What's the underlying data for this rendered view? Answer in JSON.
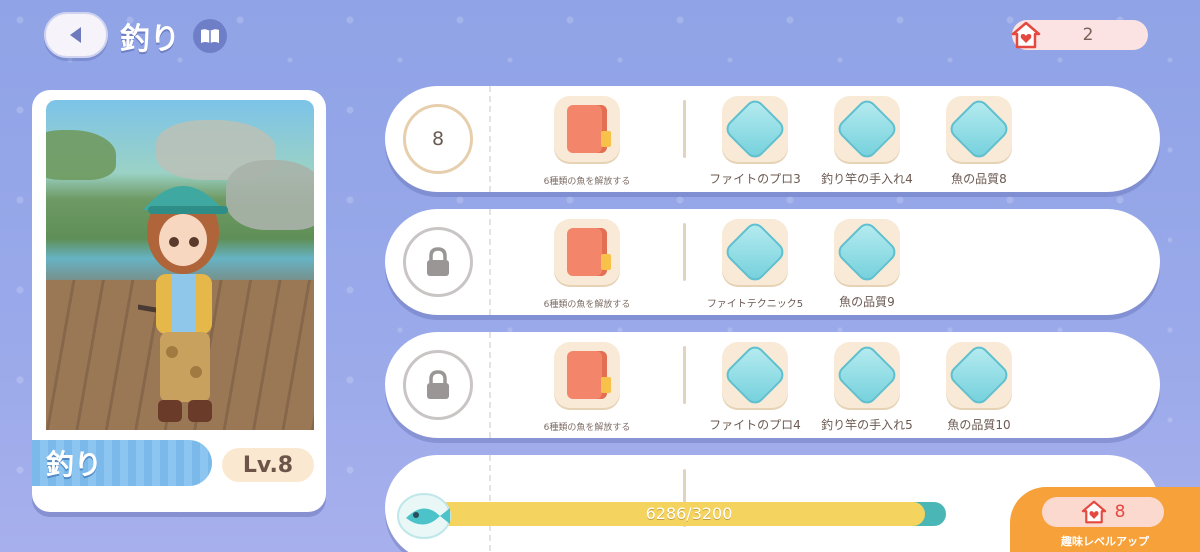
{
  "header": {
    "title": "釣り",
    "currency_value": "2"
  },
  "character": {
    "name": "釣り",
    "level": "Lv.8"
  },
  "rows": [
    {
      "level": "8",
      "locked": false,
      "unlock_label": "6種類の魚を解放する",
      "rewards": [
        "ファイトのプロ3",
        "釣り竿の手入れ4",
        "魚の品質8"
      ]
    },
    {
      "level": "",
      "locked": true,
      "unlock_label": "6種類の魚を解放する",
      "rewards": [
        "ファイトテクニック5",
        "魚の品質9"
      ]
    },
    {
      "level": "",
      "locked": true,
      "unlock_label": "6種類の魚を解放する",
      "rewards": [
        "ファイトのプロ4",
        "釣り竿の手入れ5",
        "魚の品質10"
      ]
    }
  ],
  "progress": {
    "text": "6286/3200",
    "current": 6286,
    "max": 3200,
    "fill_fraction": 0.96
  },
  "level_up": {
    "cost": "8",
    "label": "趣味レベルアップ"
  },
  "colors": {
    "background": "#9aa9ea",
    "accent_orange": "#f7a13a",
    "bar_fill": "#f4d35e",
    "bar_track": "#4bb6b6",
    "heart_red": "#e4483f"
  }
}
